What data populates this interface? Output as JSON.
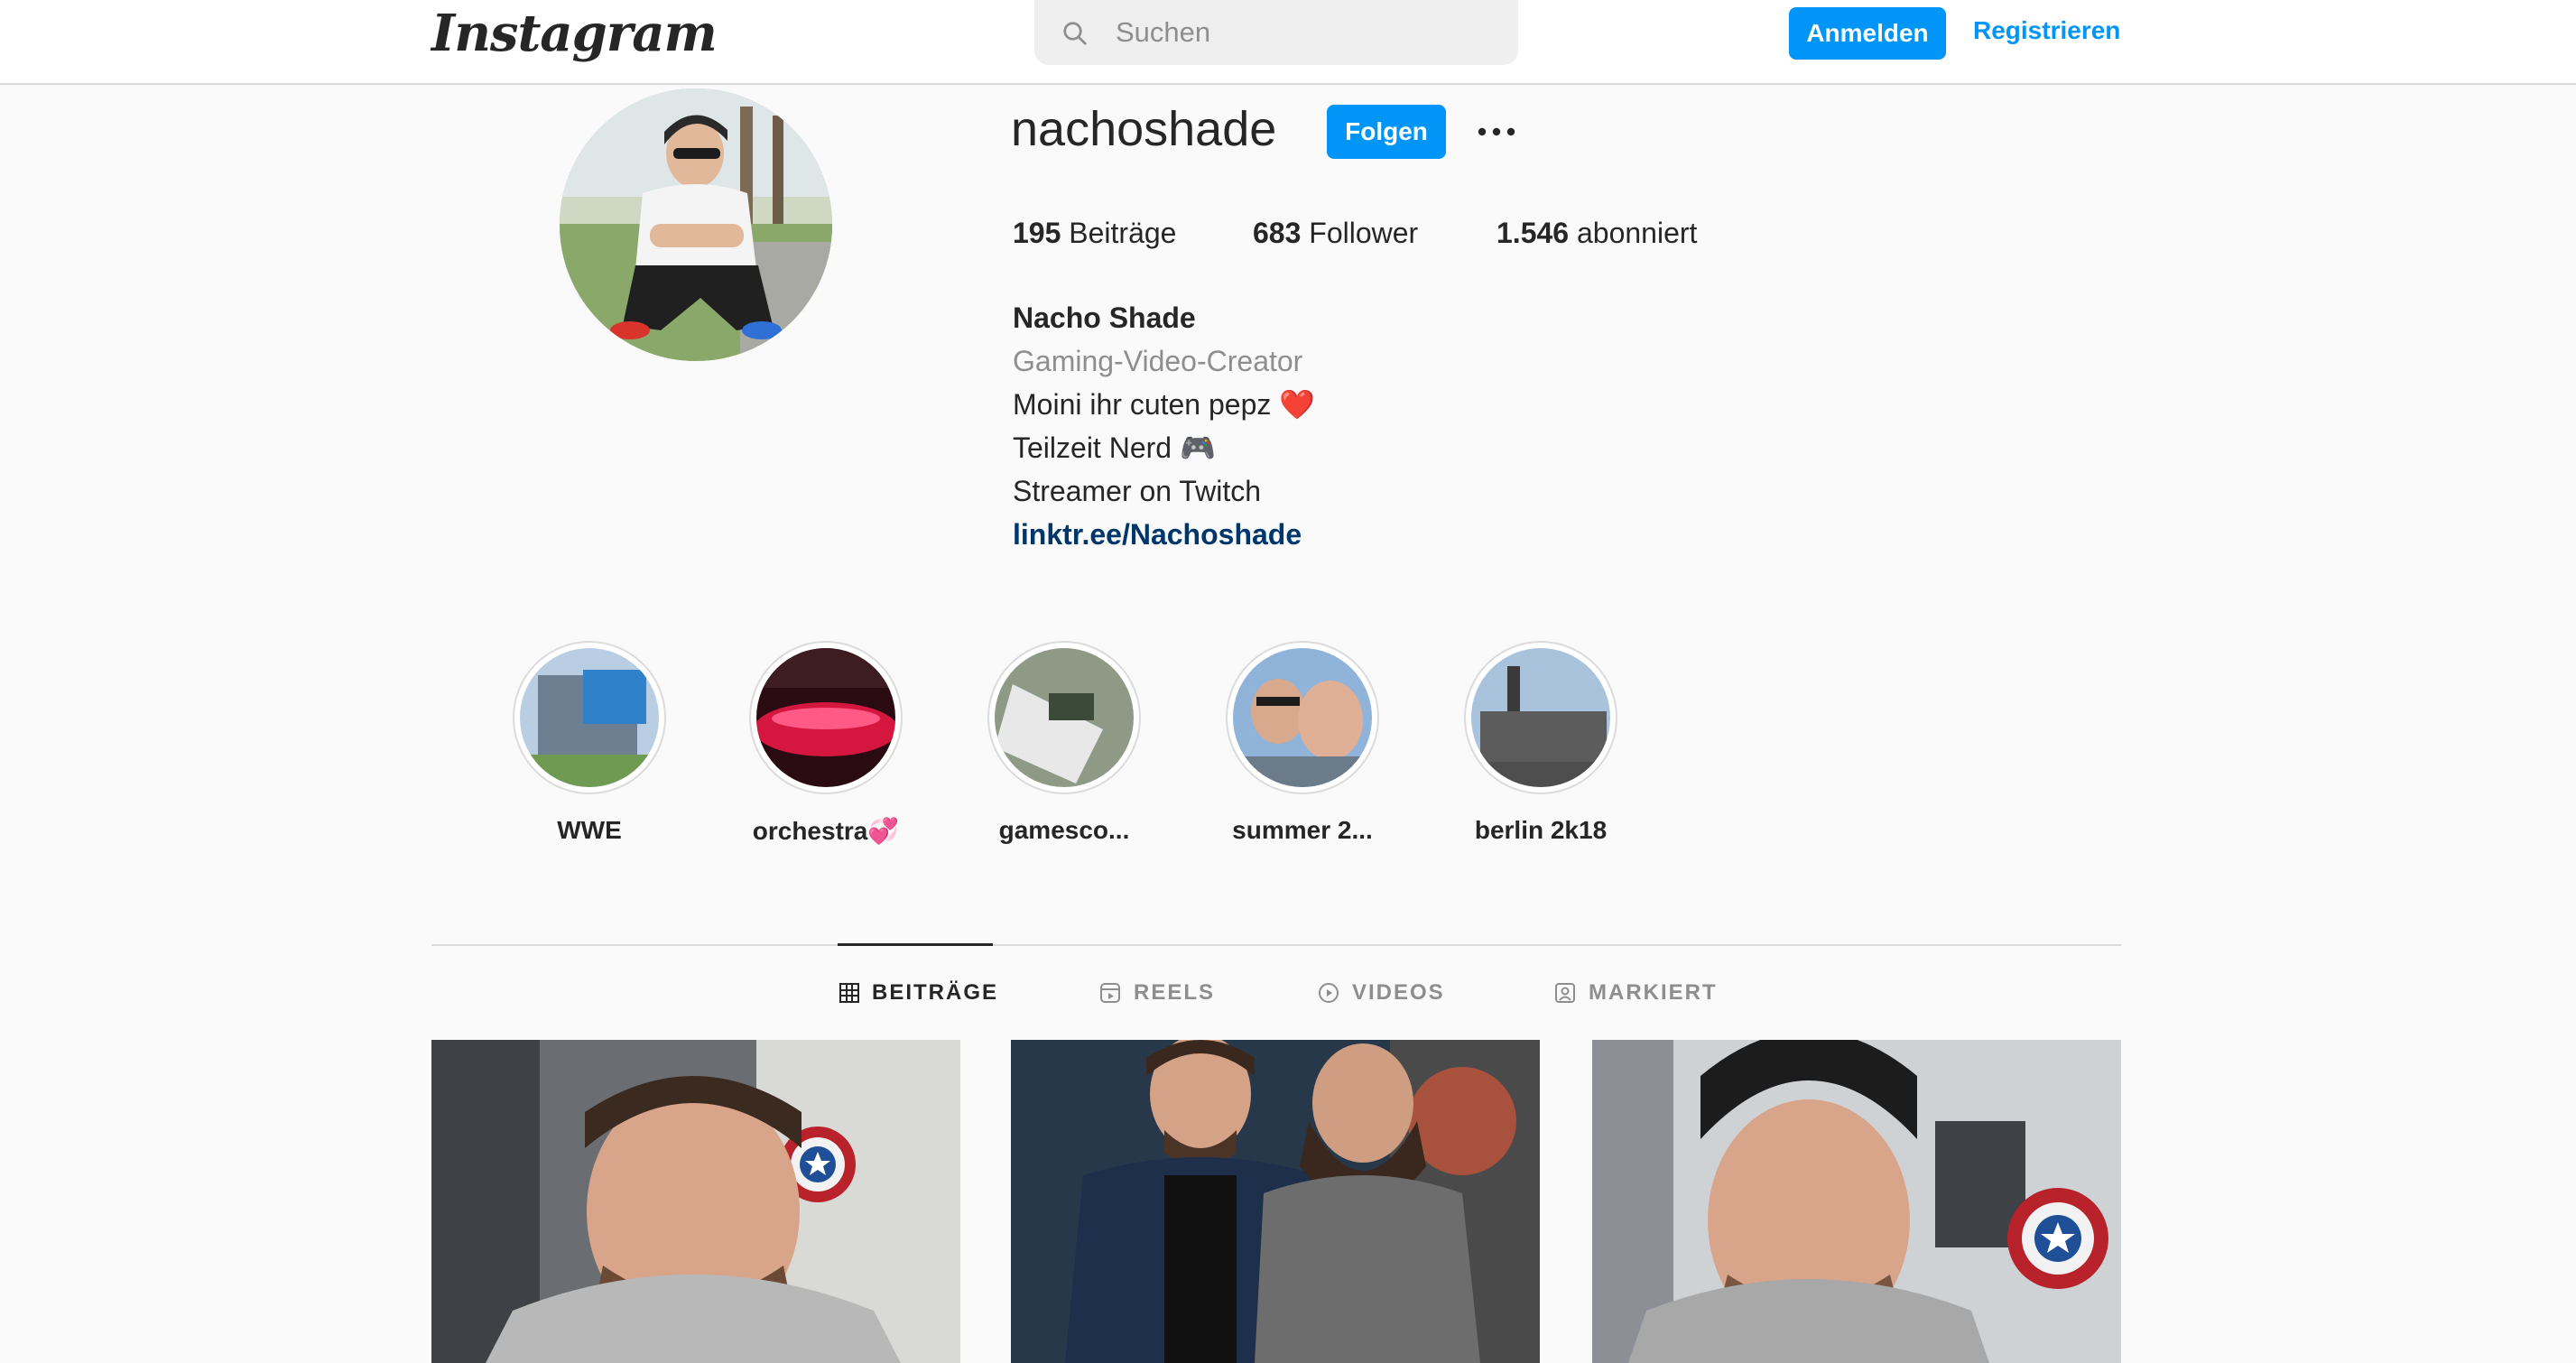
{
  "header": {
    "logo": "Instagram",
    "search_placeholder": "Suchen",
    "login_label": "Anmelden",
    "register_label": "Registrieren"
  },
  "profile": {
    "username": "nachoshade",
    "follow_label": "Folgen",
    "stats": {
      "posts_count": "195",
      "posts_label": "Beiträge",
      "followers_count": "683",
      "followers_label": "Follower",
      "following_count": "1.546",
      "following_label": "abonniert"
    },
    "full_name": "Nacho Shade",
    "category": "Gaming-Video-Creator",
    "bio_lines": [
      "Moini ihr cuten pepz ❤️",
      "Teilzeit Nerd 🎮",
      "Streamer on Twitch"
    ],
    "link": "linktr.ee/Nachoshade"
  },
  "highlights": [
    {
      "label": "WWE"
    },
    {
      "label": "orchestra💞"
    },
    {
      "label": "gamesco..."
    },
    {
      "label": "summer 2..."
    },
    {
      "label": "berlin 2k18"
    }
  ],
  "tabs": [
    {
      "label": "BEITRÄGE",
      "icon": "grid-icon",
      "active": true
    },
    {
      "label": "REELS",
      "icon": "reels-icon",
      "active": false
    },
    {
      "label": "VIDEOS",
      "icon": "play-icon",
      "active": false
    },
    {
      "label": "MARKIERT",
      "icon": "tagged-icon",
      "active": false
    }
  ],
  "colors": {
    "accent": "#0095f6",
    "link": "#00376b",
    "text": "#262626",
    "muted": "#8e8e8e",
    "background": "#fafafa"
  }
}
